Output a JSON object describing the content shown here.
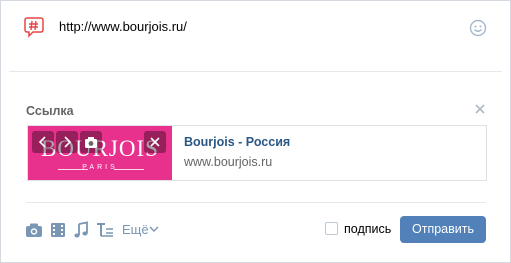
{
  "composer": {
    "text": "http://www.bourjois.ru/",
    "icons": {
      "hashtag": "hashtag-icon",
      "emoji": "smile-icon"
    }
  },
  "attachment": {
    "title": "Ссылка",
    "close_icon": "close-icon",
    "link": {
      "thumb_logo": "BOURJOIS",
      "thumb_sub": "PARIS",
      "title": "Bourjois - Россия",
      "domain": "www.bourjois.ru",
      "thumb_color": "#e8308d"
    }
  },
  "toolbar": {
    "more_label": "Ещё",
    "icons": [
      "camera-icon",
      "video-icon",
      "music-icon",
      "text-format-icon"
    ]
  },
  "footer": {
    "signature_label": "подпись",
    "signature_checked": false,
    "send_label": "Отправить"
  },
  "colors": {
    "accent": "#5181b8",
    "link": "#2a5885",
    "icon": "#7996b4"
  }
}
